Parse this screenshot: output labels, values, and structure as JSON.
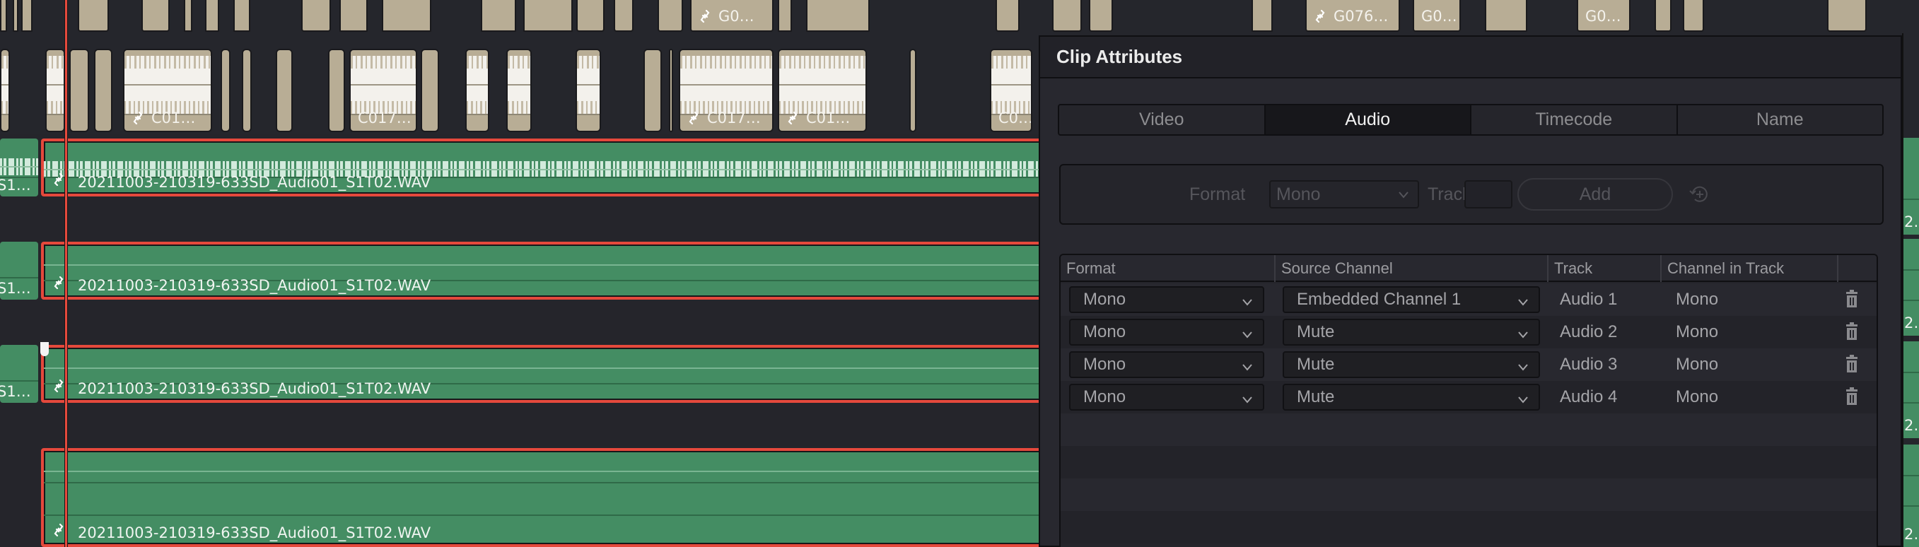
{
  "timeline": {
    "video_clips_top": [
      {
        "label": "G0…",
        "linked": true
      },
      {
        "label": "G076…",
        "linked": true
      },
      {
        "label": "G0…",
        "linked": false
      },
      {
        "label": "G0…",
        "linked": false
      }
    ],
    "audio_clips_mid": [
      {
        "label": "C01…",
        "linked": true
      },
      {
        "label": "C017…",
        "linked": false
      },
      {
        "label": "C017…",
        "linked": true
      },
      {
        "label": "C01…",
        "linked": true
      },
      {
        "label": "C0…",
        "linked": false
      }
    ],
    "audio_tracks": [
      {
        "prev_label": "S1…",
        "clip_label": "20211003-210319-633SD_Audio01_S1T02.WAV",
        "next_label": "2…",
        "has_waveform": true
      },
      {
        "prev_label": "S1…",
        "clip_label": "20211003-210319-633SD_Audio01_S1T02.WAV",
        "next_label": "2…",
        "has_waveform": false
      },
      {
        "prev_label": "S1…",
        "clip_label": "20211003-210319-633SD_Audio01_S1T02.WAV",
        "next_label": "2…",
        "has_waveform": false
      },
      {
        "prev_label": "",
        "clip_label": "20211003-210319-633SD_Audio01_S1T02.WAV",
        "next_label": "2…",
        "has_waveform": false
      }
    ],
    "colors": {
      "audio_clip_green": "#448d63",
      "selection_red": "#e5493c",
      "clip_beige": "#b8ad95"
    }
  },
  "panel": {
    "title": "Clip Attributes",
    "tabs": [
      {
        "label": "Video",
        "active": false
      },
      {
        "label": "Audio",
        "active": true
      },
      {
        "label": "Timecode",
        "active": false
      },
      {
        "label": "Name",
        "active": false
      }
    ],
    "add_section": {
      "format_label": "Format",
      "format_value": "Mono",
      "tracks_label": "Tracks",
      "tracks_value": "",
      "add_button": "Add",
      "reset_icon": "reset-add-icon"
    },
    "table": {
      "columns": [
        "Format",
        "Source Channel",
        "Track",
        "Channel in Track",
        ""
      ],
      "rows": [
        {
          "format": "Mono",
          "source_channel": "Embedded Channel 1",
          "track": "Audio 1",
          "channel_in_track": "Mono"
        },
        {
          "format": "Mono",
          "source_channel": "Mute",
          "track": "Audio 2",
          "channel_in_track": "Mono"
        },
        {
          "format": "Mono",
          "source_channel": "Mute",
          "track": "Audio 3",
          "channel_in_track": "Mono"
        },
        {
          "format": "Mono",
          "source_channel": "Mute",
          "track": "Audio 4",
          "channel_in_track": "Mono"
        }
      ]
    }
  }
}
